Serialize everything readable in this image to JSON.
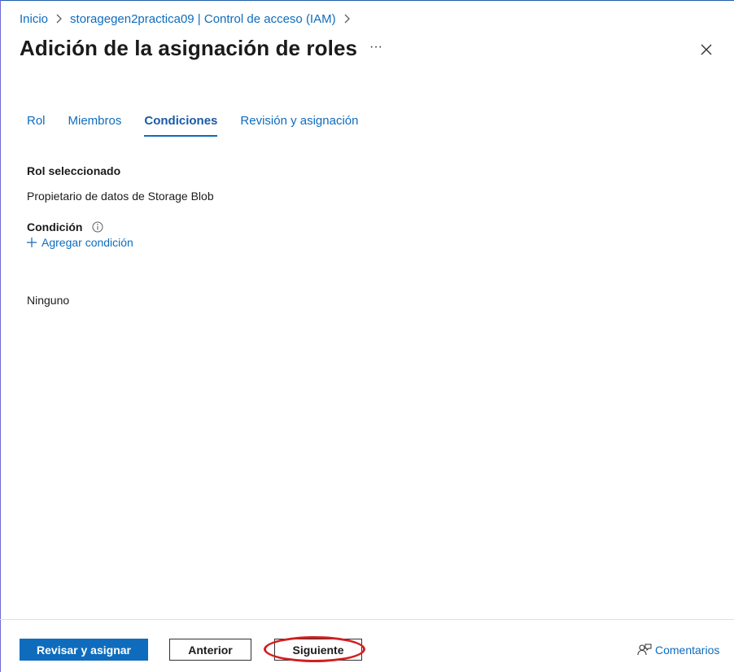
{
  "breadcrumb": {
    "items": [
      "Inicio",
      "storagegen2practica09 | Control de acceso (IAM)"
    ]
  },
  "header": {
    "title": "Adición de la asignación de roles",
    "more_label": "···"
  },
  "tabs": [
    {
      "label": "Rol",
      "active": false
    },
    {
      "label": "Miembros",
      "active": false
    },
    {
      "label": "Condiciones",
      "active": true
    },
    {
      "label": "Revisión y asignación",
      "active": false
    }
  ],
  "main": {
    "selected_role_label": "Rol seleccionado",
    "selected_role_value": "Propietario de datos de Storage Blob",
    "condition_label": "Condición",
    "add_condition_label": "Agregar condición",
    "condition_value": "Ninguno"
  },
  "footer": {
    "review_assign_label": "Revisar y asignar",
    "previous_label": "Anterior",
    "next_label": "Siguiente",
    "feedback_label": "Comentarios"
  },
  "colors": {
    "accent": "#0f6cbd",
    "highlight": "#d11f1f"
  },
  "icons": [
    "chevron-right-icon",
    "more-icon",
    "close-icon",
    "info-icon",
    "plus-icon",
    "feedback-icon"
  ]
}
